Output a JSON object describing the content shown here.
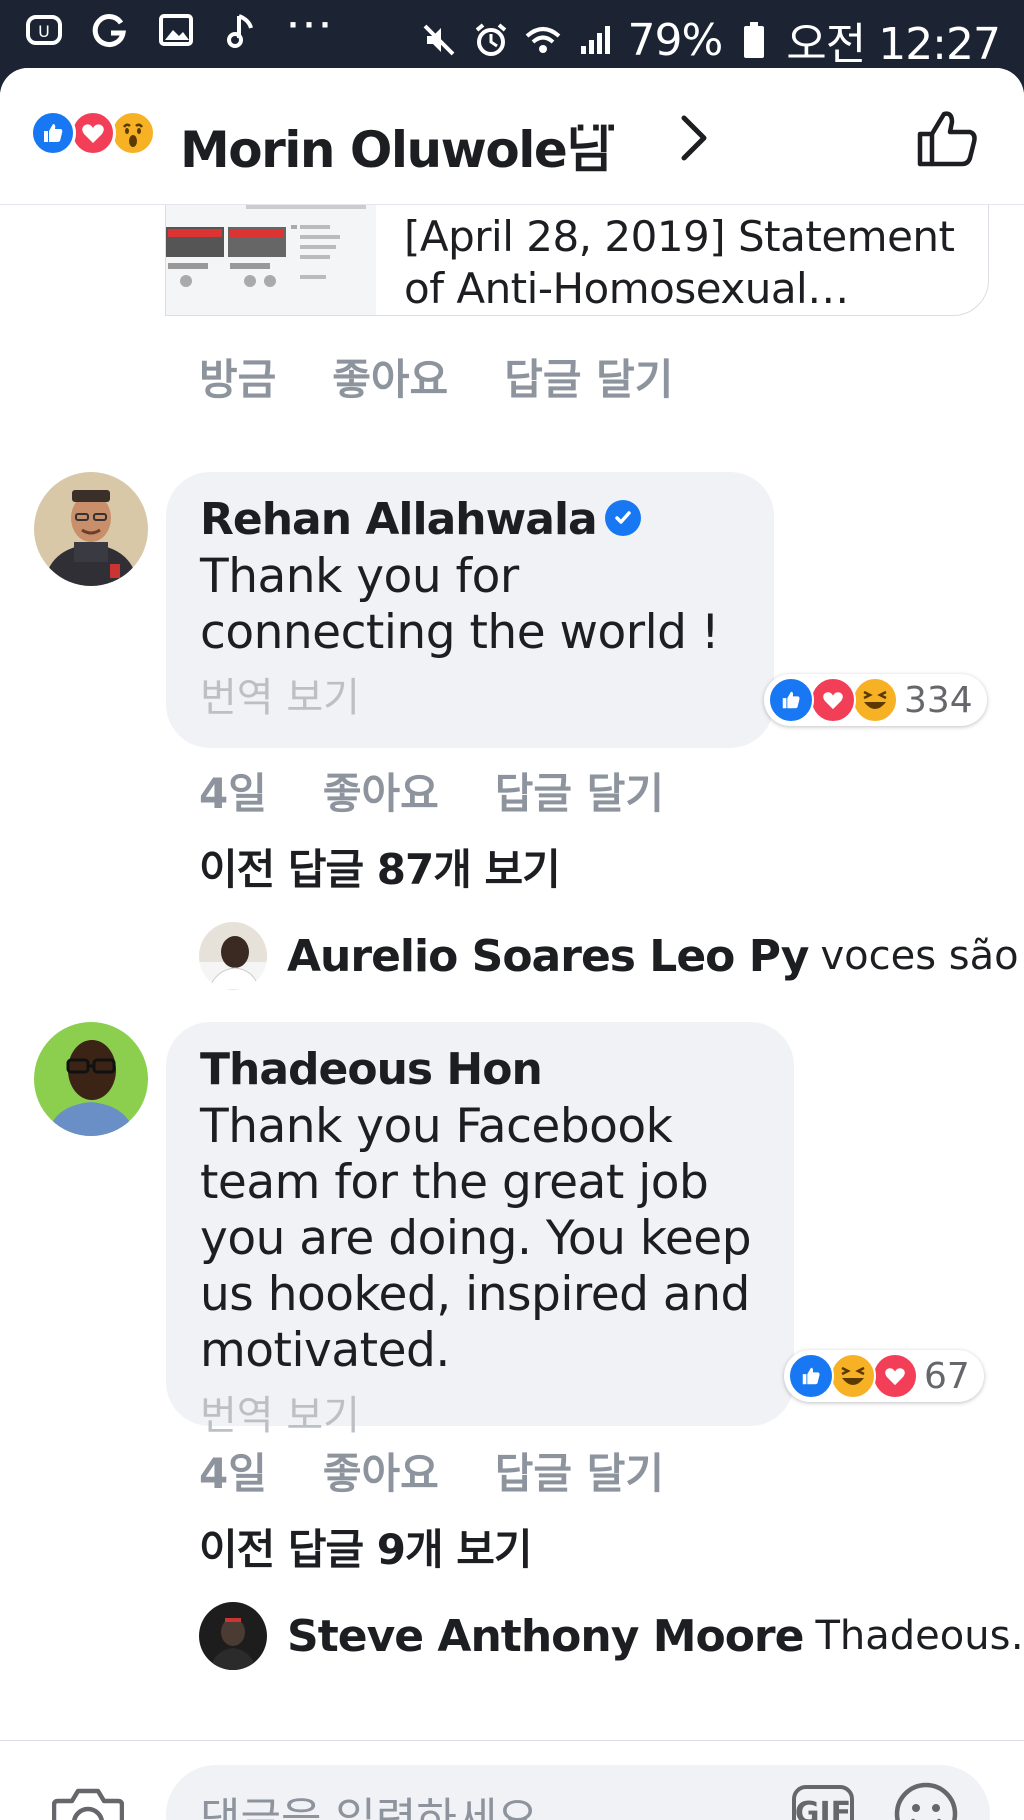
{
  "status_bar": {
    "battery": "79%",
    "time": "오전 12:27",
    "more": "···"
  },
  "header": {
    "title": "Morin Oluwole님",
    "more": "···",
    "reaction_icons": [
      "like-icon",
      "love-icon",
      "wow-icon"
    ]
  },
  "link_preview": {
    "line1": "[April 28, 2019] Statement",
    "line2": "of Anti-Homosexual…"
  },
  "first_meta": {
    "time": "방금",
    "like": "좋아요",
    "reply": "답글 달기"
  },
  "comments": [
    {
      "name": "Rehan Allahwala",
      "verified": true,
      "text_lines": [
        "Thank you for",
        "connecting the world !"
      ],
      "translate": "번역 보기",
      "reaction_icons": [
        "like-icon",
        "love-icon",
        "haha-icon"
      ],
      "reaction_count": "334",
      "time": "4일",
      "like": "좋아요",
      "reply": "답글 달기",
      "previous_replies": "이전 답글 87개 보기",
      "reply_preview": {
        "name": "Aurelio Soares Leo Py",
        "snippet": "voces são d…"
      }
    },
    {
      "name": "Thadeous Hon",
      "verified": false,
      "text_lines": [
        "Thank you Facebook",
        "team for the great job",
        "you are doing. You keep",
        "us hooked, inspired and",
        "motivated."
      ],
      "translate": "번역 보기",
      "reaction_icons": [
        "like-icon",
        "haha-icon",
        "love-icon"
      ],
      "reaction_count": "67",
      "time": "4일",
      "like": "좋아요",
      "reply": "답글 달기",
      "previous_replies": "이전 답글 9개 보기",
      "reply_preview": {
        "name": "Steve Anthony Moore",
        "snippet": "Thadeous…"
      }
    }
  ],
  "composer": {
    "placeholder": "댓글을 입력하세요...",
    "gif_label": "GIF"
  },
  "colors": {
    "facebook_blue": "#1877f2",
    "love_red": "#f33e58",
    "haha_yellow": "#f7b125",
    "bubble_gray": "#f0f2f5",
    "meta_gray": "#8d949e"
  }
}
